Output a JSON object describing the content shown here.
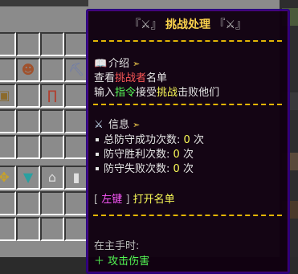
{
  "inventory": {
    "top_bar_text": "",
    "right_strip_blocks": 4
  },
  "tooltip": {
    "title_left_mark": "『⚔』",
    "title_text": "挑战处理",
    "title_right_mark": "『⚔』",
    "intro": {
      "heading": "介绍",
      "line1_a": "查看",
      "line1_b": "挑战者",
      "line1_c": "名单",
      "line2_a": "输入",
      "line2_b": "指令",
      "line2_c": "接受",
      "line2_d": "挑战",
      "line2_e": "击败他们"
    },
    "info": {
      "heading": "信息",
      "rows": [
        {
          "label": "总防守成功次数:",
          "value": "0",
          "unit": "次"
        },
        {
          "label": "防守胜利次数:",
          "value": "0",
          "unit": "次"
        },
        {
          "label": "防守失败次数:",
          "value": "0",
          "unit": "次"
        }
      ]
    },
    "action": {
      "bracket_open": "[",
      "key": "左键",
      "bracket_close": "]",
      "text": "打开名单"
    },
    "footer": {
      "main_hand": "在主手时:",
      "cut_line": "＋ 攻击伤害"
    }
  },
  "colors": {
    "tooltip_bg": "#100010",
    "tooltip_border": "#28007f",
    "divider": "#e8b800",
    "red": "#ff5555",
    "green": "#55ff55",
    "yellow": "#ffff55",
    "aqua": "#55ffff",
    "purple": "#ff55ff"
  },
  "icons": {
    "book": "book-icon",
    "sword": "sword-icon",
    "arrow": "arrow-icon"
  }
}
